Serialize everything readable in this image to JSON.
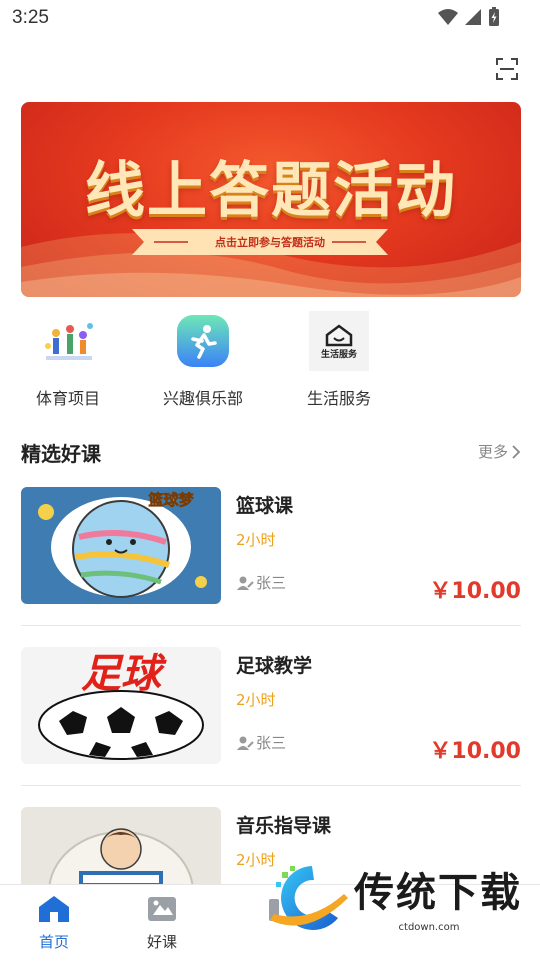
{
  "status_bar": {
    "time": "3:25"
  },
  "banner": {
    "title": "线上答题活动",
    "subtitle": "点击立即参与答题活动"
  },
  "categories": [
    {
      "label": "体育项目",
      "icon": "sports-illustration-icon"
    },
    {
      "label": "兴趣俱乐部",
      "icon": "running-person-icon"
    },
    {
      "label": "生活服务",
      "icon": "life-service-icon",
      "icon_text": "生活服务"
    }
  ],
  "section": {
    "title": "精选好课",
    "more": "更多"
  },
  "courses": [
    {
      "name": "篮球课",
      "duration": "2小时",
      "teacher": "张三",
      "price": "￥10.00",
      "thumb_text": "篮球梦"
    },
    {
      "name": "足球教学",
      "duration": "2小时",
      "teacher": "张三",
      "price": "￥10.00",
      "thumb_text": "足球"
    },
    {
      "name": "音乐指导课",
      "duration": "2小时"
    }
  ],
  "tabs": [
    {
      "label": "首页",
      "active": true
    },
    {
      "label": "好课",
      "active": false
    }
  ],
  "watermark": {
    "text": "传统下载",
    "url": "ctdown.com"
  },
  "colors": {
    "accent": "#1f6fd6",
    "price": "#e23a2a",
    "duration": "#f0a11a",
    "banner": "#e53a1f"
  }
}
